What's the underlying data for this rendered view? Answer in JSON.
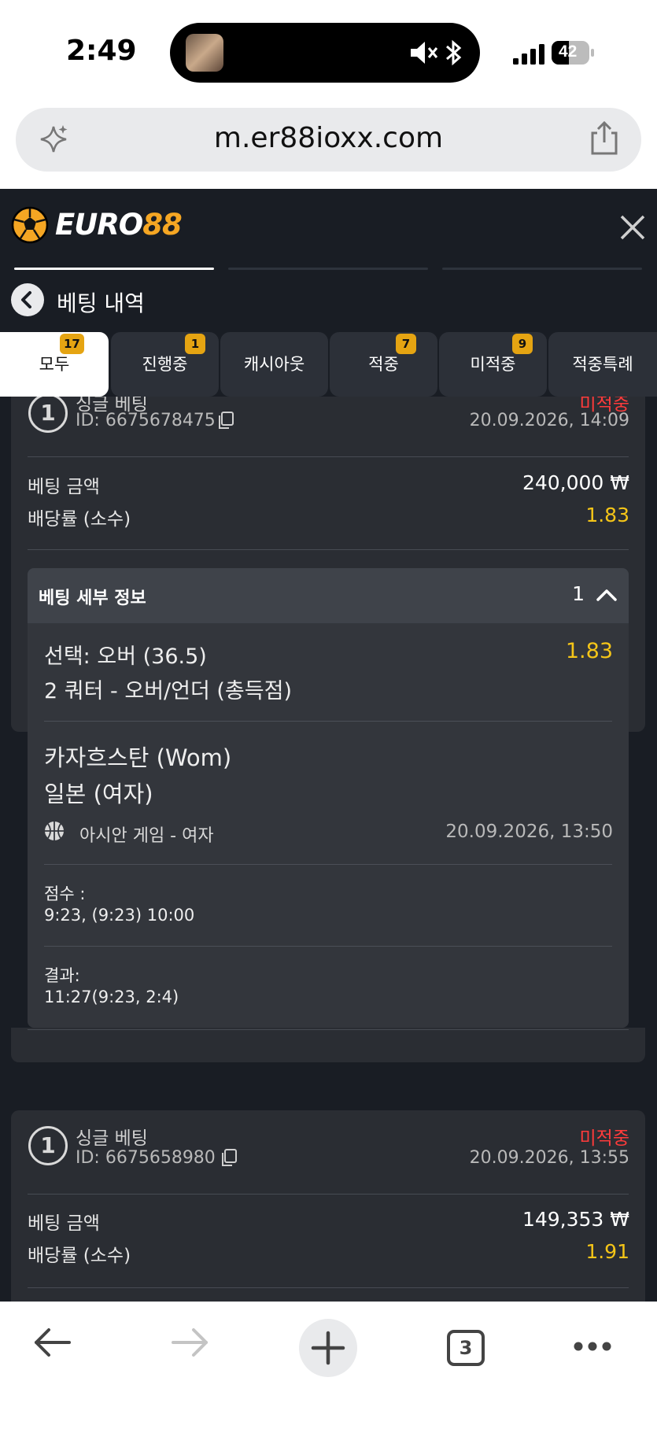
{
  "status_bar": {
    "time": "2:49",
    "battery": "42"
  },
  "browser": {
    "url": "m.er88ioxx.com",
    "tab_count": "3"
  },
  "brand": {
    "word": "EURO",
    "num": "88"
  },
  "page": {
    "title": "베팅 내역"
  },
  "tabs": [
    {
      "label": "모두",
      "badge": "17"
    },
    {
      "label": "진행중",
      "badge": "1"
    },
    {
      "label": "캐시아웃",
      "badge": ""
    },
    {
      "label": "적중",
      "badge": "7"
    },
    {
      "label": "미적중",
      "badge": "9"
    },
    {
      "label": "적중특례",
      "badge": ""
    }
  ],
  "bets": [
    {
      "num": "1",
      "type": "싱글 베팅",
      "id": "ID: 6675678475",
      "status": "미적중",
      "date": "20.09.2026, 14:09",
      "amount_label": "베팅 금액",
      "amount": "240,000 ₩",
      "odds_label": "배당률 (소수)",
      "odds": "1.83",
      "details": {
        "title": "베팅 세부 정보",
        "count": "1",
        "selection": "선택: 오버 (36.5)",
        "market": "2 쿼터 - 오버/언더 (총득점)",
        "odd": "1.83",
        "team1": "카자흐스탄 (Wom)",
        "team2": "일본 (여자)",
        "league": "아시안 게임 - 여자",
        "match_date": "20.09.2026, 13:50",
        "score_label": "점수 :",
        "score": "9:23, (9:23) 10:00",
        "result_label": "결과:",
        "result": "11:27(9:23, 2:4)"
      }
    },
    {
      "num": "1",
      "type": "싱글 베팅",
      "id": "ID: 6675658980",
      "status": "미적중",
      "date": "20.09.2026, 13:55",
      "amount_label": "베팅 금액",
      "amount": "149,353 ₩",
      "odds_label": "배당률 (소수)",
      "odds": "1.91"
    }
  ]
}
